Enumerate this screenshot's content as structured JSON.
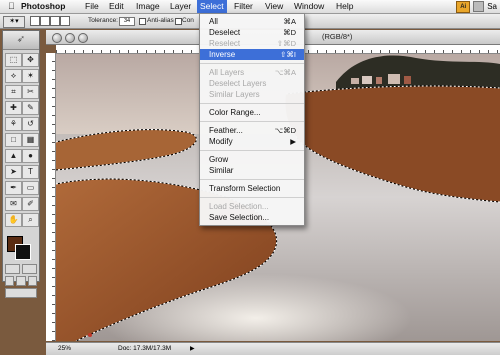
{
  "menubar": {
    "apple": "",
    "items": [
      "Photoshop",
      "File",
      "Edit",
      "Image",
      "Layer",
      "Select",
      "Filter",
      "View",
      "Window",
      "Help"
    ],
    "active": "Select",
    "right_badge": "Ai",
    "clock": "Sa"
  },
  "options_bar": {
    "tool_icon": "magic-wand-icon",
    "tolerance_label": "Tolerance:",
    "tolerance_value": "34",
    "anti_alias_label": "Anti-alias",
    "contiguous_label": "Con"
  },
  "document": {
    "title_fragment": "(RGB/8*)",
    "zoom": "25%",
    "doc_size": "Doc: 17.3M/17.3M"
  },
  "swatches": {
    "foreground": "#5a2c12",
    "background": "#111111"
  },
  "select_menu": {
    "items": [
      {
        "label": "All",
        "shortcut": "⌘A",
        "enabled": true
      },
      {
        "label": "Deselect",
        "shortcut": "⌘D",
        "enabled": true
      },
      {
        "label": "Reselect",
        "shortcut": "⇧⌘D",
        "enabled": false
      },
      {
        "label": "Inverse",
        "shortcut": "⇧⌘I",
        "enabled": true,
        "highlighted": true
      },
      {
        "separator": true
      },
      {
        "label": "All Layers",
        "shortcut": "⌥⌘A",
        "enabled": false
      },
      {
        "label": "Deselect Layers",
        "shortcut": "",
        "enabled": false
      },
      {
        "label": "Similar Layers",
        "shortcut": "",
        "enabled": false
      },
      {
        "separator": true
      },
      {
        "label": "Color Range...",
        "shortcut": "",
        "enabled": true
      },
      {
        "separator": true
      },
      {
        "label": "Feather...",
        "shortcut": "⌥⌘D",
        "enabled": true
      },
      {
        "label": "Modify",
        "shortcut": "▶",
        "enabled": true
      },
      {
        "separator": true
      },
      {
        "label": "Grow",
        "shortcut": "",
        "enabled": true
      },
      {
        "label": "Similar",
        "shortcut": "",
        "enabled": true
      },
      {
        "separator": true
      },
      {
        "label": "Transform Selection",
        "shortcut": "",
        "enabled": true
      },
      {
        "separator": true
      },
      {
        "label": "Load Selection...",
        "shortcut": "",
        "enabled": false
      },
      {
        "label": "Save Selection...",
        "shortcut": "",
        "enabled": true
      }
    ]
  },
  "tools": [
    "marquee-tool-icon",
    "move-tool-icon",
    "lasso-tool-icon",
    "magic-wand-tool-icon",
    "crop-tool-icon",
    "slice-tool-icon",
    "healing-brush-icon",
    "brush-tool-icon",
    "clone-stamp-icon",
    "history-brush-icon",
    "eraser-tool-icon",
    "gradient-tool-icon",
    "blur-tool-icon",
    "dodge-tool-icon",
    "path-select-icon",
    "type-tool-icon",
    "pen-tool-icon",
    "shape-tool-icon",
    "notes-tool-icon",
    "eyedropper-tool-icon",
    "hand-tool-icon",
    "zoom-tool-icon"
  ],
  "tool_glyphs": [
    "⬚",
    "✥",
    "⟡",
    "✶",
    "⌗",
    "✂",
    "✚",
    "✎",
    "⚘",
    "↺",
    "□",
    "▦",
    "▲",
    "●",
    "➤",
    "T",
    "✒",
    "▭",
    "✉",
    "✐",
    "✋",
    "⌕"
  ]
}
